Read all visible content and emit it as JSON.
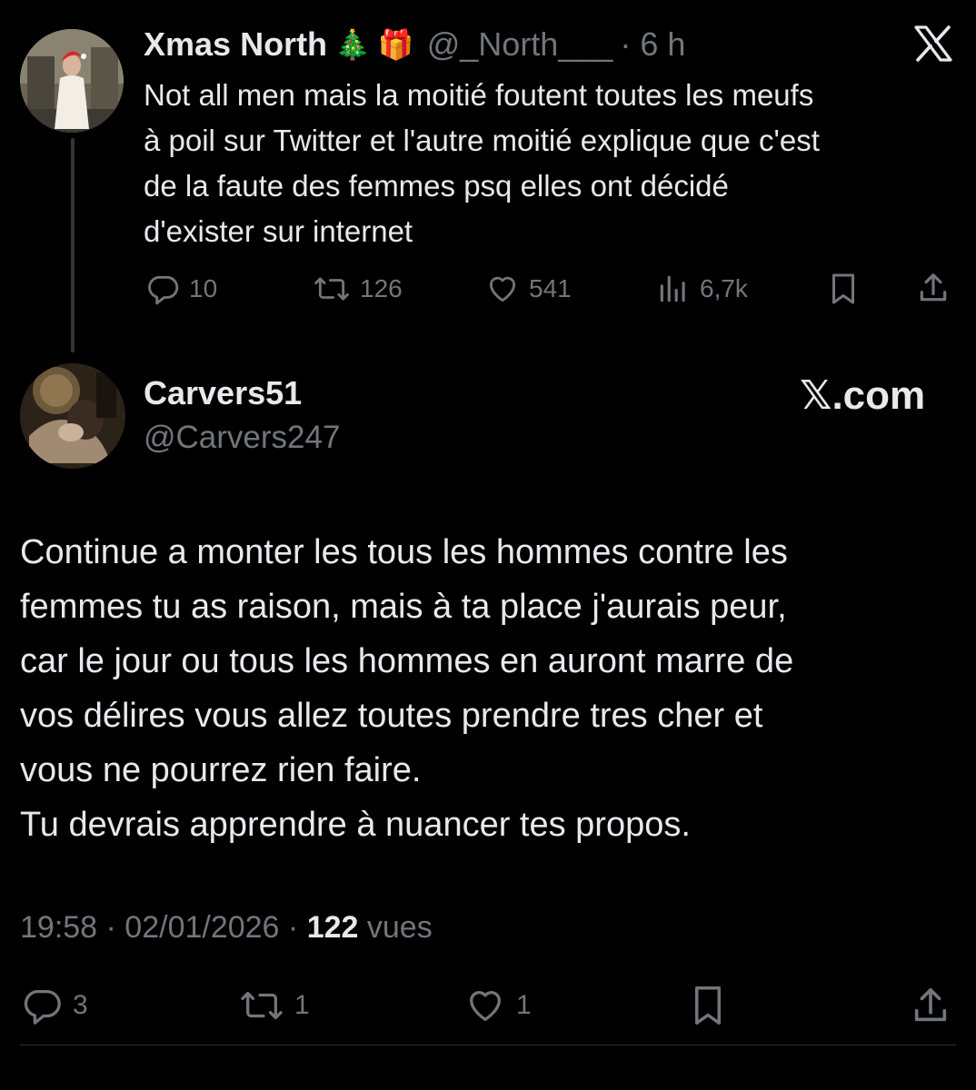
{
  "quoted_tweet": {
    "display_name": "Xmas North",
    "emoji_1": "🎄",
    "emoji_2": "🎁",
    "handle": "@_North___",
    "time": "· 6 h",
    "text_lines": [
      "Not all men mais la moitié foutent toutes les meufs",
      "à poil sur Twitter et l'autre moitié explique que c'est",
      "de la faute des femmes psq elles ont décidé",
      "d'exister sur internet"
    ],
    "stats": {
      "replies": "10",
      "reposts": "126",
      "likes": "541",
      "views": "6,7k"
    },
    "icons": [
      "reply-icon",
      "repost-icon",
      "like-icon",
      "views-icon",
      "bookmark-icon",
      "share-icon",
      "x-logo-icon"
    ]
  },
  "reply_tweet": {
    "display_name": "Carvers51",
    "handle": "@Carvers247",
    "brand": "𝕏.com",
    "text_lines": [
      "Continue a monter les tous les hommes contre les",
      "femmes tu as raison, mais à ta place j'aurais peur,",
      "car le jour ou tous les hommes en auront marre de",
      "vos délires vous allez toutes prendre tres cher et",
      "vous ne pourrez rien faire.",
      "Tu devrais apprendre à nuancer tes propos."
    ],
    "timestamp": "19:58 · 02/01/2026 ·",
    "views_count": "122",
    "views_label": "vues",
    "stats": {
      "replies": "3",
      "reposts": "1",
      "likes": "1"
    }
  },
  "colors": {
    "background": "#000000",
    "text": "#e7e9ea",
    "muted": "#71767b",
    "line": "#333639"
  }
}
